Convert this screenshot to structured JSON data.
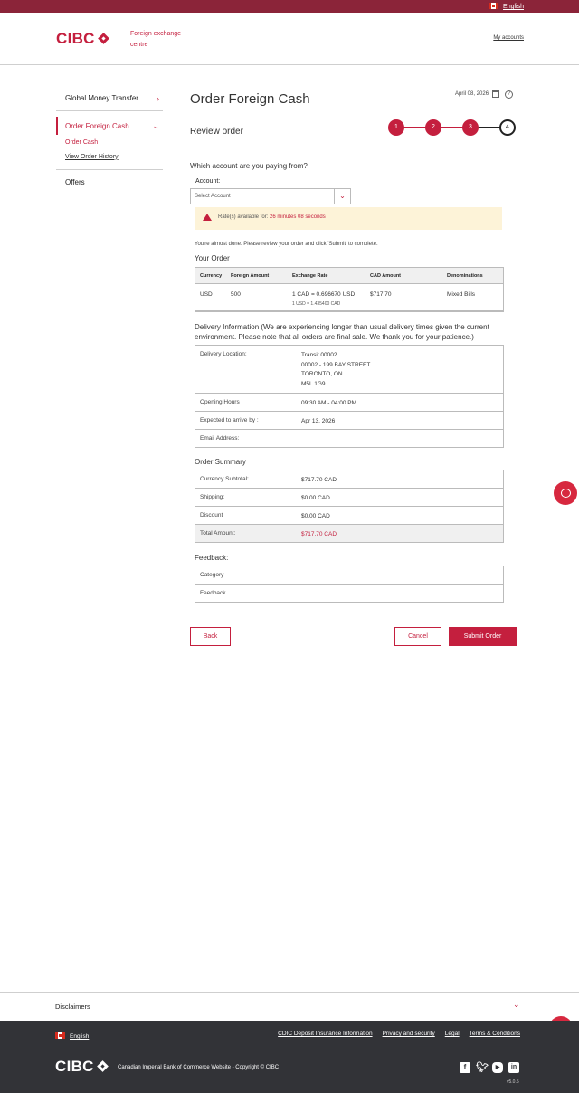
{
  "topbar": {
    "language": "English"
  },
  "header": {
    "brand": "CIBC",
    "subtitle": "Foreign exchange centre",
    "my_accounts": "My accounts"
  },
  "sidebar": {
    "items": [
      {
        "label": "Global Money Transfer"
      },
      {
        "label": "Order Foreign Cash"
      },
      {
        "label": "Order Cash"
      },
      {
        "label": "View Order History"
      },
      {
        "label": "Offers"
      }
    ]
  },
  "page": {
    "title": "Order Foreign Cash",
    "date": "April 08, 2026",
    "subtitle": "Review order",
    "steps": [
      "1",
      "2",
      "3",
      "4"
    ],
    "current_step": 4
  },
  "account": {
    "question": "Which account are you paying from?",
    "label": "Account:",
    "placeholder": "Select Account"
  },
  "rate": {
    "prefix": "Rate(s) available for:",
    "countdown": "26 minutes 08 seconds"
  },
  "instruction": "You're almost done. Please review your order and click 'Submit' to complete.",
  "your_order": {
    "title": "Your Order",
    "headers": [
      "Currency",
      "Foreign Amount",
      "Exchange Rate",
      "CAD Amount",
      "Denominations"
    ],
    "row": {
      "currency": "USD",
      "foreign_amount": "500",
      "exchange_rate": "1 CAD = 0.696670 USD",
      "exchange_rate_inverse": "1 USD = 1.435400 CAD",
      "cad_amount": "$717.70",
      "denominations": "Mixed Bills"
    }
  },
  "delivery": {
    "title": "Delivery Information (We are experiencing longer than usual delivery times given the current environment. Please note that all orders are final sale. We thank you for your patience.)",
    "location_label": "Delivery Location:",
    "location_lines": [
      "Transit 00002",
      "00002 - 199 BAY STREET",
      "TORONTO, ON",
      "M5L 1G9"
    ],
    "hours_label": "Opening Hours",
    "hours": "09:30 AM - 04:00 PM",
    "arrive_label": "Expected to arrive by :",
    "arrive": "Apr 13, 2026",
    "email_label": "Email Address:"
  },
  "summary": {
    "title": "Order Summary",
    "subtotal_label": "Currency Subtotal:",
    "subtotal": "$717.70 CAD",
    "shipping_label": "Shipping:",
    "shipping": "$0.00 CAD",
    "discount_label": "Discount",
    "discount": "$0.00 CAD",
    "total_label": "Total Amount:",
    "total": "$717.70 CAD"
  },
  "feedback": {
    "title": "Feedback:",
    "category_label": "Category",
    "feedback_label": "Feedback"
  },
  "buttons": {
    "back": "Back",
    "cancel": "Cancel",
    "submit": "Submit Order"
  },
  "footer": {
    "disclaimers": "Disclaimers",
    "language": "English",
    "links": [
      "CDIC Deposit Insurance Information",
      "Privacy and security",
      "Legal",
      "Terms & Conditions"
    ],
    "copyright": "Canadian Imperial Bank of Commerce Website - Copyright © CIBC",
    "version": "v5.0.5",
    "socials": [
      "facebook-icon",
      "twitter-icon",
      "youtube-icon",
      "linkedin-icon"
    ]
  },
  "colors": {
    "brand": "#c41f3e",
    "topbar": "#8b2439",
    "footer": "#323337",
    "warning_bg": "#fdf3d8"
  }
}
